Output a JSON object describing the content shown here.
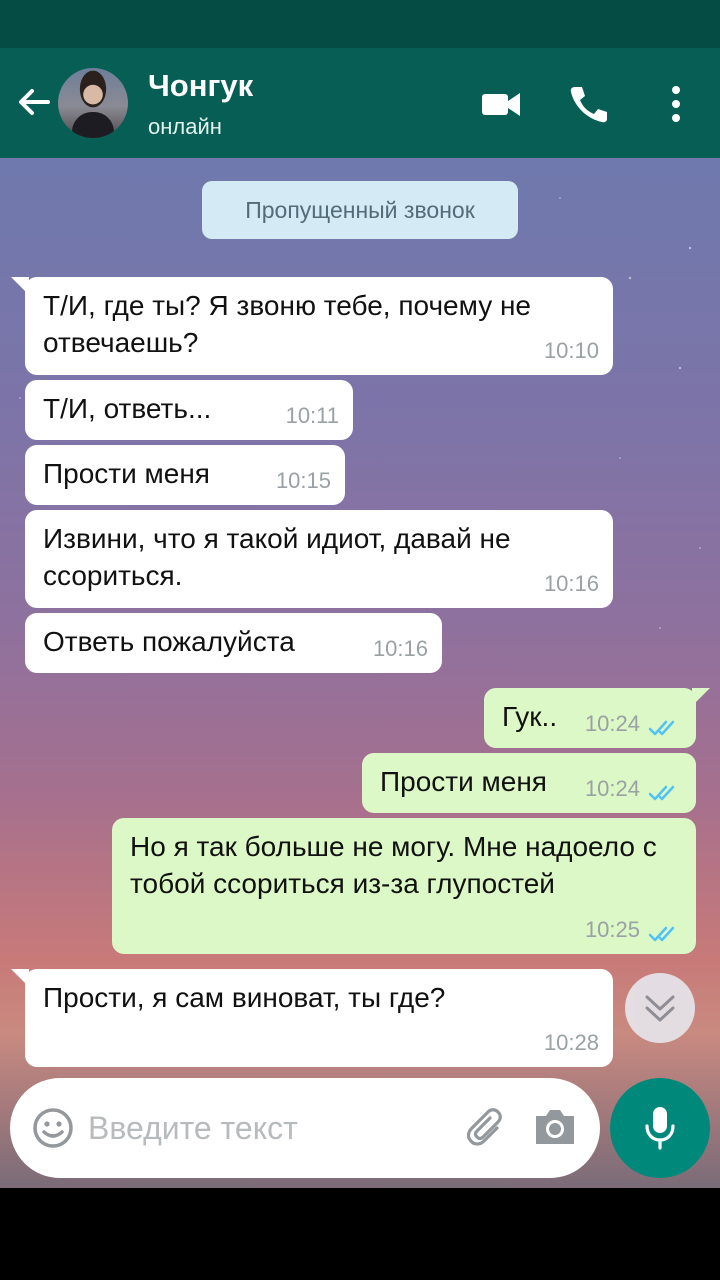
{
  "header": {
    "contact_name": "Чонгук",
    "contact_status": "онлайн"
  },
  "system": {
    "missed_call": "Пропущенный звонок"
  },
  "messages": [
    {
      "dir": "in",
      "text": "Т/И, где ты? Я звоню тебе, почему не отвечаешь?",
      "time": "10:10"
    },
    {
      "dir": "in",
      "text": "Т/И, ответь...",
      "time": "10:11"
    },
    {
      "dir": "in",
      "text": "Прости меня",
      "time": "10:15"
    },
    {
      "dir": "in",
      "text": "Извини, что я такой идиот, давай не ссориться.",
      "time": "10:16"
    },
    {
      "dir": "in",
      "text": "Ответь пожалуйста",
      "time": "10:16"
    },
    {
      "dir": "out",
      "text": "Гук..",
      "time": "10:24",
      "status": "read"
    },
    {
      "dir": "out",
      "text": "Прости меня",
      "time": "10:24",
      "status": "read"
    },
    {
      "dir": "out",
      "text": "Но я так больше не могу. Мне надоело с тобой ссориться из-за глупостей",
      "time": "10:25",
      "status": "read"
    },
    {
      "dir": "in",
      "text": "Прости, я сам виноват, ты где?",
      "time": "10:28"
    }
  ],
  "composer": {
    "placeholder": "Введите текст"
  },
  "colors": {
    "header": "#075e54",
    "status_bar": "#054c44",
    "outgoing_bubble": "#dcf8c6",
    "incoming_bubble": "#ffffff",
    "read_ticks": "#4fc3f7",
    "mic_button": "#00897b"
  }
}
